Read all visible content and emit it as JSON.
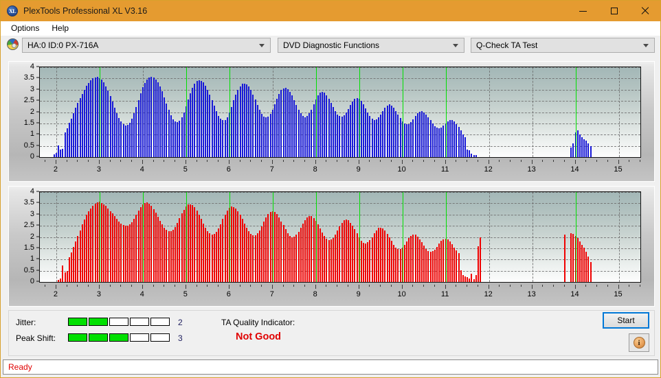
{
  "window": {
    "title": "PlexTools Professional XL V3.16",
    "app_icon": "XL",
    "accent_color": "#e59b30",
    "minimize_label": "Minimize",
    "maximize_label": "Maximize",
    "close_label": "Close"
  },
  "menu": {
    "items": [
      {
        "label": "Options"
      },
      {
        "label": "Help"
      }
    ]
  },
  "selectors": {
    "drive": {
      "value": "HA:0 ID:0  PX-716A"
    },
    "function": {
      "value": "DVD Diagnostic Functions"
    },
    "test": {
      "value": "Q-Check TA Test"
    }
  },
  "results": {
    "jitter_label": "Jitter:",
    "jitter_value": "2",
    "jitter_filled": 2,
    "jitter_total": 5,
    "peak_shift_label": "Peak Shift:",
    "peak_shift_value": "3",
    "peak_shift_filled": 3,
    "peak_shift_total": 5,
    "ta_label": "TA Quality Indicator:",
    "ta_value": "Not Good",
    "ta_color": "#e00000",
    "meter_on_color": "#00e000",
    "start_label": "Start",
    "info_label": "i"
  },
  "status": {
    "text": "Ready",
    "color": "#e00000"
  },
  "chart_data": [
    {
      "id": "jitter-chart",
      "type": "bar",
      "title": "",
      "xlabel": "",
      "ylabel": "",
      "color": "#1818d8",
      "marker_color": "#00e000",
      "grid": true,
      "legend": "none",
      "xlim": [
        1.62,
        15.5
      ],
      "ylim": [
        0,
        4
      ],
      "yticks": [
        0,
        0.5,
        1,
        1.5,
        2,
        2.5,
        3,
        3.5,
        4
      ],
      "ytick_labels": [
        "0",
        "0.5",
        "1",
        "1.5",
        "2",
        "2.5",
        "3",
        "3.5",
        "4"
      ],
      "xticks": [
        2,
        3,
        4,
        5,
        6,
        7,
        8,
        9,
        10,
        11,
        12,
        13,
        14,
        15
      ],
      "xtick_labels": [
        "2",
        "3",
        "4",
        "5",
        "6",
        "7",
        "8",
        "9",
        "10",
        "11",
        "12",
        "13",
        "14",
        "15"
      ],
      "markers": [
        3,
        5,
        6,
        8,
        9,
        10,
        11,
        14
      ],
      "x": [
        1.95,
        2.0,
        2.05,
        2.1,
        2.15,
        2.2,
        2.25,
        2.3,
        2.35,
        2.4,
        2.45,
        2.5,
        2.55,
        2.6,
        2.65,
        2.7,
        2.75,
        2.8,
        2.85,
        2.9,
        2.95,
        3.0,
        3.05,
        3.1,
        3.15,
        3.2,
        3.25,
        3.3,
        3.35,
        3.4,
        3.45,
        3.5,
        3.55,
        3.6,
        3.65,
        3.7,
        3.75,
        3.8,
        3.85,
        3.9,
        3.95,
        4.0,
        4.05,
        4.1,
        4.15,
        4.2,
        4.25,
        4.3,
        4.35,
        4.4,
        4.45,
        4.5,
        4.55,
        4.6,
        4.65,
        4.7,
        4.75,
        4.8,
        4.85,
        4.9,
        4.95,
        5.0,
        5.05,
        5.1,
        5.15,
        5.2,
        5.25,
        5.3,
        5.35,
        5.4,
        5.45,
        5.5,
        5.55,
        5.6,
        5.65,
        5.7,
        5.75,
        5.8,
        5.85,
        5.9,
        5.95,
        6.0,
        6.05,
        6.1,
        6.15,
        6.2,
        6.25,
        6.3,
        6.35,
        6.4,
        6.45,
        6.5,
        6.55,
        6.6,
        6.65,
        6.7,
        6.75,
        6.8,
        6.85,
        6.9,
        6.95,
        7.0,
        7.05,
        7.1,
        7.15,
        7.2,
        7.25,
        7.3,
        7.35,
        7.4,
        7.45,
        7.5,
        7.55,
        7.6,
        7.65,
        7.7,
        7.75,
        7.8,
        7.85,
        7.9,
        7.95,
        8.0,
        8.05,
        8.1,
        8.15,
        8.2,
        8.25,
        8.3,
        8.35,
        8.4,
        8.45,
        8.5,
        8.55,
        8.6,
        8.65,
        8.7,
        8.75,
        8.8,
        8.85,
        8.9,
        8.95,
        9.0,
        9.05,
        9.1,
        9.15,
        9.2,
        9.25,
        9.3,
        9.35,
        9.4,
        9.45,
        9.5,
        9.55,
        9.6,
        9.65,
        9.7,
        9.75,
        9.8,
        9.85,
        9.9,
        9.95,
        10.0,
        10.05,
        10.1,
        10.15,
        10.2,
        10.25,
        10.3,
        10.35,
        10.4,
        10.45,
        10.5,
        10.55,
        10.6,
        10.65,
        10.7,
        10.75,
        10.8,
        10.85,
        10.9,
        10.95,
        11.0,
        11.05,
        11.1,
        11.15,
        11.2,
        11.25,
        11.3,
        11.35,
        11.4,
        11.45,
        11.5,
        11.55,
        11.6,
        11.65,
        11.7,
        13.9,
        13.95,
        14.0,
        14.05,
        14.1,
        14.15,
        14.2,
        14.25,
        14.3,
        14.35,
        14.4
      ],
      "values": [
        0.12,
        0.18,
        0.52,
        0.34,
        0.38,
        1.1,
        1.28,
        1.52,
        1.72,
        1.95,
        2.2,
        2.42,
        2.62,
        2.82,
        3.0,
        3.18,
        3.3,
        3.42,
        3.5,
        3.55,
        3.56,
        3.52,
        3.44,
        3.32,
        3.16,
        2.95,
        2.72,
        2.46,
        2.2,
        1.95,
        1.74,
        1.58,
        1.47,
        1.42,
        1.44,
        1.54,
        1.72,
        1.96,
        2.24,
        2.54,
        2.84,
        3.1,
        3.3,
        3.45,
        3.53,
        3.56,
        3.53,
        3.45,
        3.32,
        3.14,
        2.92,
        2.66,
        2.38,
        2.1,
        1.86,
        1.68,
        1.58,
        1.56,
        1.62,
        1.76,
        1.98,
        2.26,
        2.56,
        2.85,
        3.08,
        3.26,
        3.38,
        3.42,
        3.4,
        3.32,
        3.18,
        3.0,
        2.78,
        2.54,
        2.28,
        2.04,
        1.84,
        1.7,
        1.64,
        1.66,
        1.78,
        1.98,
        2.24,
        2.52,
        2.78,
        3.0,
        3.16,
        3.26,
        3.28,
        3.24,
        3.14,
        2.98,
        2.78,
        2.56,
        2.32,
        2.1,
        1.92,
        1.8,
        1.76,
        1.8,
        1.92,
        2.12,
        2.36,
        2.6,
        2.82,
        2.98,
        3.06,
        3.08,
        3.02,
        2.9,
        2.74,
        2.54,
        2.32,
        2.12,
        1.94,
        1.82,
        1.78,
        1.82,
        1.94,
        2.12,
        2.34,
        2.56,
        2.74,
        2.86,
        2.9,
        2.86,
        2.76,
        2.6,
        2.42,
        2.22,
        2.04,
        1.9,
        1.82,
        1.8,
        1.86,
        1.98,
        2.14,
        2.32,
        2.48,
        2.6,
        2.64,
        2.6,
        2.5,
        2.36,
        2.18,
        2.0,
        1.84,
        1.72,
        1.66,
        1.68,
        1.76,
        1.9,
        2.06,
        2.2,
        2.3,
        2.34,
        2.3,
        2.2,
        2.06,
        1.9,
        1.74,
        1.6,
        1.5,
        1.46,
        1.48,
        1.56,
        1.68,
        1.82,
        1.94,
        2.02,
        2.04,
        2.0,
        1.9,
        1.78,
        1.64,
        1.5,
        1.38,
        1.3,
        1.28,
        1.32,
        1.4,
        1.5,
        1.58,
        1.64,
        1.64,
        1.58,
        1.48,
        1.34,
        1.18,
        1.02,
        0.88,
        0.34,
        0.3,
        0.16,
        0.1,
        0.08,
        0.42,
        0.62,
        1.1,
        1.18,
        1.02,
        0.9,
        0.8,
        0.72,
        0.62,
        0.5
      ]
    },
    {
      "id": "peak-shift-chart",
      "type": "bar",
      "title": "",
      "xlabel": "",
      "ylabel": "",
      "color": "#f00000",
      "marker_color": "#00e000",
      "grid": true,
      "legend": "none",
      "xlim": [
        1.62,
        15.5
      ],
      "ylim": [
        0,
        4
      ],
      "yticks": [
        0,
        0.5,
        1,
        1.5,
        2,
        2.5,
        3,
        3.5,
        4
      ],
      "ytick_labels": [
        "0",
        "0.5",
        "1",
        "1.5",
        "2",
        "2.5",
        "3",
        "3.5",
        "4"
      ],
      "xticks": [
        2,
        3,
        4,
        5,
        6,
        7,
        8,
        9,
        10,
        11,
        12,
        13,
        14,
        15
      ],
      "xtick_labels": [
        "2",
        "3",
        "4",
        "5",
        "6",
        "7",
        "8",
        "9",
        "10",
        "11",
        "12",
        "13",
        "14",
        "15"
      ],
      "markers": [
        3,
        4,
        5,
        6,
        7,
        8,
        9,
        10,
        11,
        14
      ],
      "x": [
        2.05,
        2.1,
        2.15,
        2.2,
        2.25,
        2.3,
        2.35,
        2.4,
        2.45,
        2.5,
        2.55,
        2.6,
        2.65,
        2.7,
        2.75,
        2.8,
        2.85,
        2.9,
        2.95,
        3.0,
        3.05,
        3.1,
        3.15,
        3.2,
        3.25,
        3.3,
        3.35,
        3.4,
        3.45,
        3.5,
        3.55,
        3.6,
        3.65,
        3.7,
        3.75,
        3.8,
        3.85,
        3.9,
        3.95,
        4.0,
        4.05,
        4.1,
        4.15,
        4.2,
        4.25,
        4.3,
        4.35,
        4.4,
        4.45,
        4.5,
        4.55,
        4.6,
        4.65,
        4.7,
        4.75,
        4.8,
        4.85,
        4.9,
        4.95,
        5.0,
        5.05,
        5.1,
        5.15,
        5.2,
        5.25,
        5.3,
        5.35,
        5.4,
        5.45,
        5.5,
        5.55,
        5.6,
        5.65,
        5.7,
        5.75,
        5.8,
        5.85,
        5.9,
        5.95,
        6.0,
        6.05,
        6.1,
        6.15,
        6.2,
        6.25,
        6.3,
        6.35,
        6.4,
        6.45,
        6.5,
        6.55,
        6.6,
        6.65,
        6.7,
        6.75,
        6.8,
        6.85,
        6.9,
        6.95,
        7.0,
        7.05,
        7.1,
        7.15,
        7.2,
        7.25,
        7.3,
        7.35,
        7.4,
        7.45,
        7.5,
        7.55,
        7.6,
        7.65,
        7.7,
        7.75,
        7.8,
        7.85,
        7.9,
        7.95,
        8.0,
        8.05,
        8.1,
        8.15,
        8.2,
        8.25,
        8.3,
        8.35,
        8.4,
        8.45,
        8.5,
        8.55,
        8.6,
        8.65,
        8.7,
        8.75,
        8.8,
        8.85,
        8.9,
        8.95,
        9.0,
        9.05,
        9.1,
        9.15,
        9.2,
        9.25,
        9.3,
        9.35,
        9.4,
        9.45,
        9.5,
        9.55,
        9.6,
        9.65,
        9.7,
        9.75,
        9.8,
        9.85,
        9.9,
        9.95,
        10.0,
        10.05,
        10.1,
        10.15,
        10.2,
        10.25,
        10.3,
        10.35,
        10.4,
        10.45,
        10.5,
        10.55,
        10.6,
        10.65,
        10.7,
        10.75,
        10.8,
        10.85,
        10.9,
        10.95,
        11.0,
        11.05,
        11.1,
        11.15,
        11.2,
        11.25,
        11.3,
        11.35,
        11.4,
        11.45,
        11.5,
        11.55,
        11.6,
        11.65,
        11.7,
        11.75,
        11.8,
        13.75,
        13.9,
        13.95,
        14.0,
        14.05,
        14.1,
        14.15,
        14.2,
        14.25,
        14.3,
        14.35,
        14.4,
        14.45,
        14.5,
        14.55
      ],
      "values": [
        0.1,
        0.14,
        0.74,
        0.42,
        0.5,
        1.1,
        1.3,
        1.56,
        1.8,
        2.04,
        2.3,
        2.56,
        2.78,
        2.98,
        3.14,
        3.28,
        3.4,
        3.48,
        3.54,
        3.56,
        3.52,
        3.46,
        3.38,
        3.28,
        3.16,
        3.04,
        2.92,
        2.8,
        2.7,
        2.6,
        2.54,
        2.5,
        2.5,
        2.56,
        2.66,
        2.82,
        3.0,
        3.18,
        3.34,
        3.46,
        3.52,
        3.53,
        3.48,
        3.38,
        3.24,
        3.08,
        2.9,
        2.72,
        2.56,
        2.42,
        2.32,
        2.26,
        2.26,
        2.32,
        2.44,
        2.62,
        2.84,
        3.04,
        3.22,
        3.36,
        3.44,
        3.46,
        3.42,
        3.32,
        3.18,
        3.0,
        2.8,
        2.6,
        2.42,
        2.26,
        2.16,
        2.12,
        2.14,
        2.22,
        2.38,
        2.58,
        2.8,
        3.0,
        3.18,
        3.3,
        3.36,
        3.34,
        3.26,
        3.14,
        2.98,
        2.8,
        2.6,
        2.42,
        2.26,
        2.14,
        2.08,
        2.08,
        2.16,
        2.3,
        2.48,
        2.68,
        2.86,
        3.02,
        3.12,
        3.16,
        3.12,
        3.02,
        2.88,
        2.7,
        2.52,
        2.34,
        2.18,
        2.06,
        2.0,
        2.02,
        2.1,
        2.24,
        2.42,
        2.6,
        2.76,
        2.88,
        2.94,
        2.92,
        2.84,
        2.72,
        2.56,
        2.38,
        2.2,
        2.04,
        1.92,
        1.86,
        1.88,
        1.96,
        2.1,
        2.28,
        2.46,
        2.62,
        2.74,
        2.78,
        2.74,
        2.64,
        2.5,
        2.34,
        2.16,
        1.98,
        1.84,
        1.74,
        1.72,
        1.76,
        1.86,
        2.0,
        2.16,
        2.3,
        2.4,
        2.42,
        2.38,
        2.28,
        2.14,
        1.98,
        1.82,
        1.66,
        1.54,
        1.48,
        1.48,
        1.54,
        1.66,
        1.8,
        1.94,
        2.06,
        2.12,
        2.1,
        2.02,
        1.9,
        1.76,
        1.62,
        1.48,
        1.38,
        1.34,
        1.36,
        1.44,
        1.56,
        1.7,
        1.82,
        1.9,
        1.92,
        1.88,
        1.8,
        1.68,
        1.54,
        1.4,
        1.28,
        0.52,
        0.32,
        0.24,
        0.2,
        0.14,
        0.38,
        0.12,
        0.32,
        1.58,
        1.98,
        2.12,
        2.16,
        2.14,
        2.06,
        1.94,
        1.8,
        1.66,
        1.52,
        1.34,
        1.12,
        0.9
      ]
    }
  ]
}
